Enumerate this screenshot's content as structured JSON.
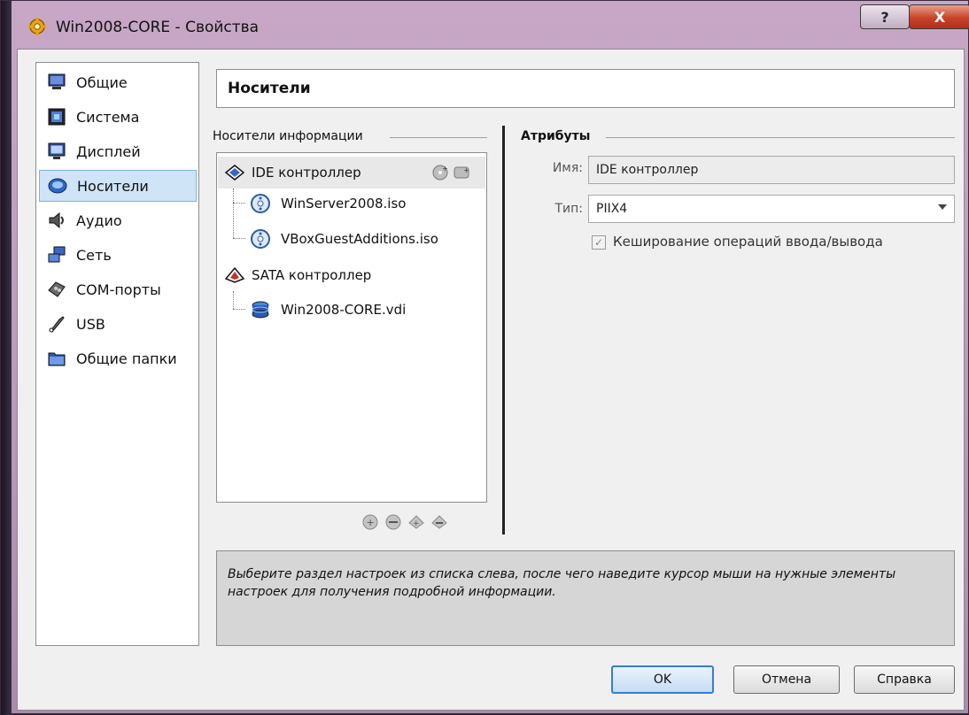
{
  "window": {
    "title": "Win2008-CORE - Свойства",
    "help_glyph": "?",
    "close_glyph": "X"
  },
  "sidebar": {
    "items": [
      {
        "label": "Общие",
        "icon": "general-monitor-icon"
      },
      {
        "label": "Система",
        "icon": "system-chip-icon"
      },
      {
        "label": "Дисплей",
        "icon": "display-icon"
      },
      {
        "label": "Носители",
        "icon": "storage-disk-icon",
        "active": true
      },
      {
        "label": "Аудио",
        "icon": "audio-speaker-icon"
      },
      {
        "label": "Сеть",
        "icon": "network-icon"
      },
      {
        "label": "COM-порты",
        "icon": "com-port-icon"
      },
      {
        "label": "USB",
        "icon": "usb-icon"
      },
      {
        "label": "Общие папки",
        "icon": "shared-folder-icon"
      }
    ]
  },
  "header": {
    "title": "Носители"
  },
  "storage": {
    "group_label": "Носители информации",
    "tree": {
      "ide": {
        "label": "IDE контроллер",
        "children": [
          "WinServer2008.iso",
          "VBoxGuestAdditions.iso"
        ]
      },
      "sata": {
        "label": "SATA контроллер",
        "children": [
          "Win2008-CORE.vdi"
        ]
      }
    }
  },
  "attributes": {
    "group_label": "Атрибуты",
    "name_label": "Имя:",
    "name_value": "IDE контроллер",
    "type_label": "Тип:",
    "type_value": "PIIX4",
    "cache_label": "Кеширование операций ввода/вывода",
    "cache_checked": true
  },
  "info": {
    "text": "Выберите раздел настроек из списка слева, после чего наведите курсор мыши на нужные элементы настроек для получения подробной информации."
  },
  "buttons": {
    "ok": "OK",
    "cancel": "Отмена",
    "help": "Справка"
  },
  "colors": {
    "accent": "#3a7bd5",
    "selection": "#cfe4f7"
  }
}
